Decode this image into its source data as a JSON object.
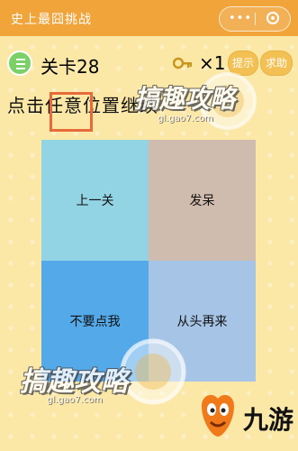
{
  "app": {
    "title": "史上最囧挑战",
    "capsule_dots": "•••"
  },
  "header": {
    "level_label": "关卡28",
    "key_count": "×1",
    "hint_label": "提示",
    "help_label": "求助"
  },
  "instruction": {
    "text": "点击任意位置继续",
    "highlighted_chars": "任意"
  },
  "grid": {
    "top_left": "上一关",
    "top_right": "发呆",
    "bottom_left": "不要点我",
    "bottom_right": "从头再来"
  },
  "watermark": {
    "title": "搞趣攻略",
    "url": "gl.gao7.com"
  },
  "brand": {
    "name": "九游"
  },
  "colors": {
    "titlebar": "#f1a43a",
    "background": "#fbe7a6",
    "highlight": "#e76b3a",
    "cell_prev": "#93d4e4",
    "cell_daze": "#d0bcae",
    "cell_dont": "#54a9e9",
    "cell_restart": "#a6c4e6"
  }
}
